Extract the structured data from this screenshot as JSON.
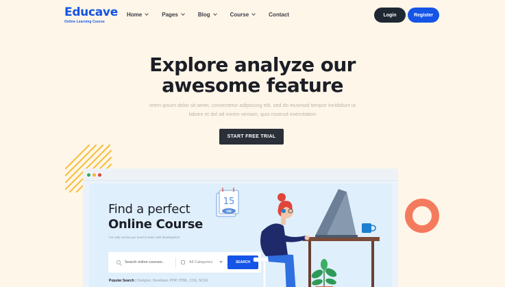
{
  "brand": {
    "name": "Educave",
    "tagline": "Online Learning Course"
  },
  "nav": {
    "items": [
      {
        "label": "Home"
      },
      {
        "label": "Pages"
      },
      {
        "label": "Blog"
      },
      {
        "label": "Course"
      },
      {
        "label": "Contact"
      }
    ],
    "login_label": "Login",
    "register_label": "Register"
  },
  "hero": {
    "title_line1": "Explore analyze our",
    "title_line2": "awesome feature",
    "desc_line1": "orem ipsum dolor sit amet, consectetur adipiscing elit, sed do eiusmod tempor incididunt ut",
    "desc_line2": "labore et dol ad minim veniam, quis nostrud exercitation",
    "cta_label": "START FREE TRIAL"
  },
  "mock": {
    "title_line1": "Find a perfect",
    "title_line2": "Online Course",
    "desc": "For only course you need to learn web development",
    "search_placeholder": "Search online courses..",
    "category_label": "All Categories",
    "search_button": "SEARCH",
    "popular_label": "Popular Search :",
    "popular_items": "Designer, Developer, PHP, HTML, CSS, SCSS",
    "calendar_day": "15",
    "calendar_badge": "ON"
  },
  "colors": {
    "background": "#fef6e8",
    "brand_blue": "#1454e6",
    "dark": "#1f2832",
    "accent_coral": "#f47a5e",
    "accent_yellow": "#f6c043",
    "dot_red": "#e0453a",
    "dot_yellow": "#f2b33d",
    "dot_green": "#2fae5c"
  }
}
